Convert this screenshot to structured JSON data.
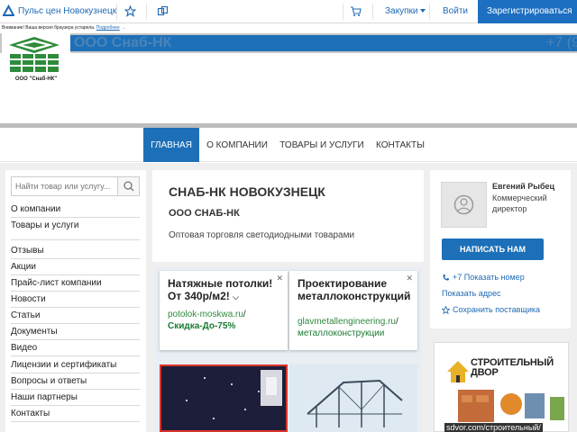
{
  "topbar": {
    "brand": "Пульс цен Новокузнецк",
    "purchases": "Закупки",
    "login": "Войти",
    "register": "Зарегистрироваться"
  },
  "header": {
    "warning_text": "Внимание! Ваша версия браузера устарела.",
    "warning_link": "Подробнее",
    "company_name": "ООО Снаб-НК",
    "phone": "+7 (9",
    "logo_caption": "ООО \"Снаб-НК\""
  },
  "nav": {
    "items": [
      "ГЛАВНАЯ",
      "О КОМПАНИИ",
      "ТОВАРЫ И УСЛУГИ",
      "КОНТАКТЫ"
    ]
  },
  "sidebar": {
    "search_placeholder": "Найти товар или услугу...",
    "items": [
      "О компании",
      "Товары и услуги",
      "Отзывы",
      "Акции",
      "Прайс-лист компании",
      "Новости",
      "Статьи",
      "Документы",
      "Видео",
      "Лицензии и сертификаты",
      "Вопросы и ответы",
      "Наши партнеры",
      "Контакты"
    ]
  },
  "main": {
    "title": "СНАБ-НК НОВОКУЗНЕЦК",
    "subtitle": "ООО СНАБ-НК",
    "description": "Оптовая торговля светодиодными товарами"
  },
  "ads": [
    {
      "title": "Натяжные потолки! От 340р/м2!",
      "url": "potolok-moskwa.ru",
      "slash": "/",
      "extra": "Скидка-До-75%"
    },
    {
      "title": "Проектирование металлоконструкций",
      "url": "glavmetallengineering.ru",
      "slash": "/",
      "extra": "металлоконструкции"
    }
  ],
  "contact": {
    "name": "Евгений Рыбец",
    "role": "Коммерческий директор",
    "write_button": "НАПИСАТЬ НАМ",
    "show_phone": "+7 Показать номер",
    "show_address": "Показать адрес",
    "save_supplier": "Сохранить поставщика"
  },
  "banner": {
    "title_line1": "СТРОИТЕЛЬНЫЙ",
    "title_line2": "ДВОР",
    "url": "sdvor.com/строительный/"
  },
  "colors": {
    "accent": "#1d70b8",
    "link": "#1e69b4",
    "ad_green": "#1a7a32"
  }
}
